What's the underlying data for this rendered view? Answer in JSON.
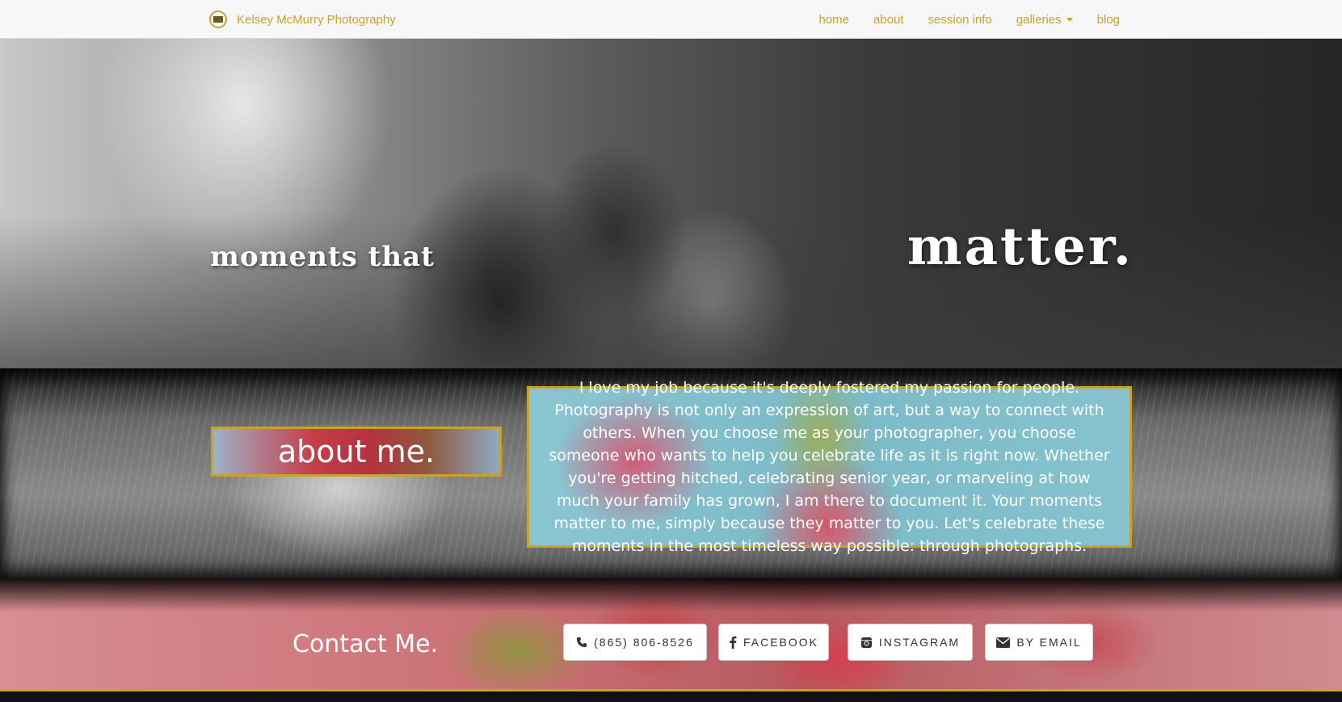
{
  "navbar": {
    "brand": "Kelsey McMurry Photography",
    "links": [
      {
        "label": "home"
      },
      {
        "label": "about"
      },
      {
        "label": "session info"
      },
      {
        "label": "galleries"
      },
      {
        "label": "blog"
      }
    ]
  },
  "hero": {
    "small_text": "moments that",
    "big_text": "matter."
  },
  "about": {
    "title": "about me.",
    "text": "I love my job because it's deeply fostered my passion for people. Photography is not only an expression of art, but a way to connect with others. When you choose me as your photographer, you choose someone who wants to help you celebrate life as it is right now. Whether you're getting hitched, celebrating senior year, or marveling at how much your family has grown, I am there to document it. Your moments matter to me, simply because they matter to you. Let's celebrate these moments in the most timeless way possible: through photographs."
  },
  "contact": {
    "title": "Contact Me.",
    "buttons": [
      {
        "label": "(865) 806-8526",
        "icon": "phone-icon"
      },
      {
        "label": "FACEBOOK",
        "icon": "facebook-icon"
      },
      {
        "label": "INSTAGRAM",
        "icon": "instagram-icon"
      },
      {
        "label": "BY EMAIL",
        "icon": "envelope-icon"
      }
    ]
  },
  "colors": {
    "accent": "#c9a227",
    "nav_bg": "#f7f7f7"
  }
}
